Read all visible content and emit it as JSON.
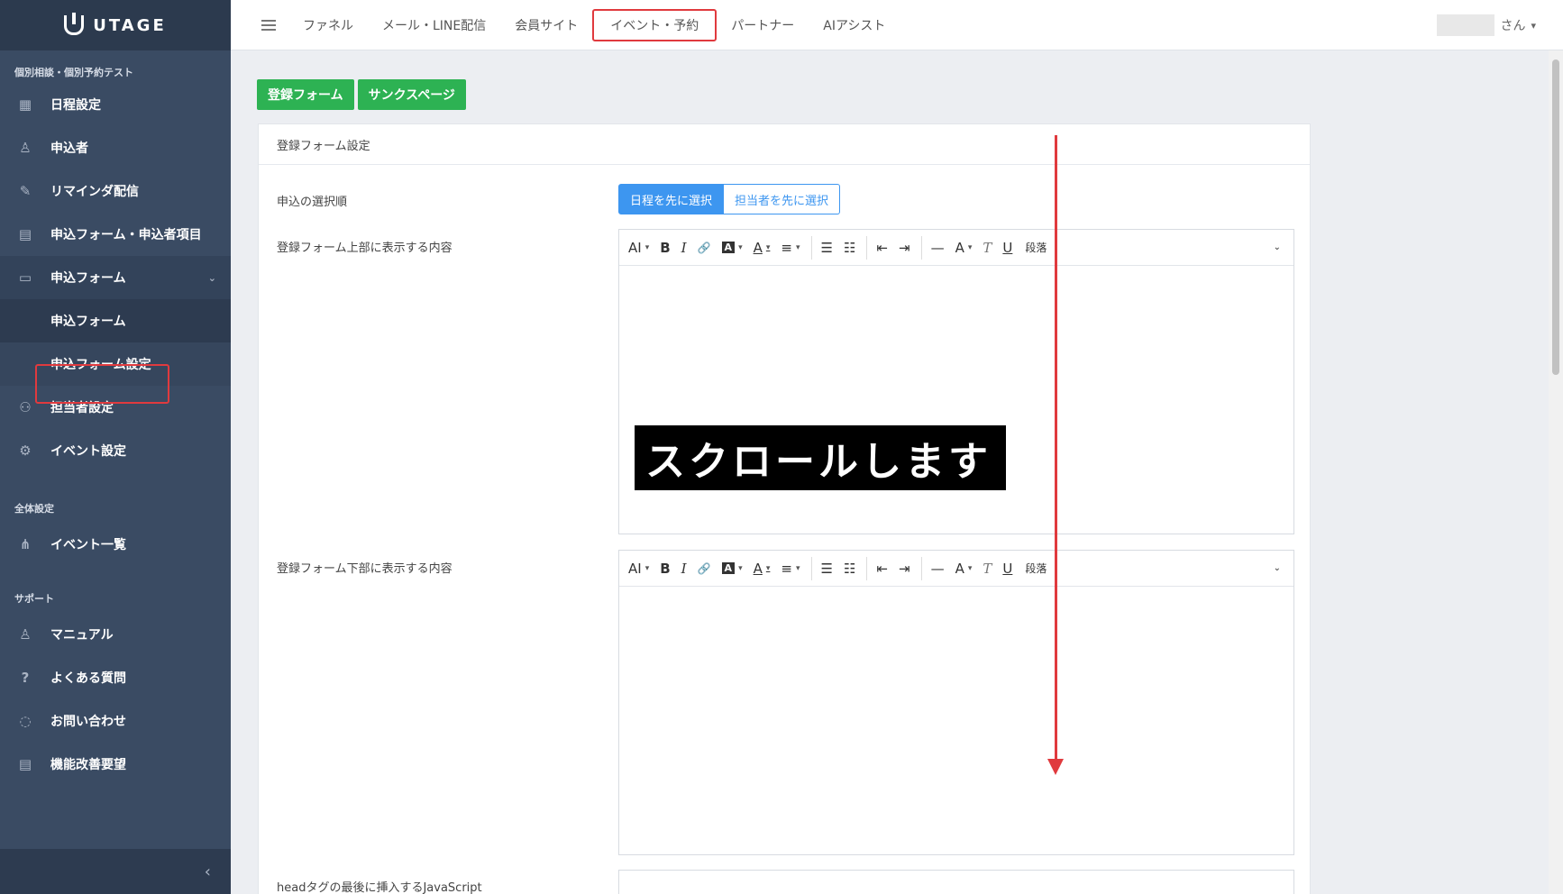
{
  "app": {
    "logo_text": "UTAGE"
  },
  "sidebar": {
    "section1": "個別相談・個別予約テスト",
    "items1": [
      {
        "label": "日程設定",
        "icon": "calendar-icon"
      },
      {
        "label": "申込者",
        "icon": "user-icon"
      },
      {
        "label": "リマインダ配信",
        "icon": "pencil-icon"
      },
      {
        "label": "申込フォーム・申込者項目",
        "icon": "table-icon"
      },
      {
        "label": "申込フォーム",
        "icon": "form-icon"
      }
    ],
    "sub_items": [
      "申込フォーム",
      "申込フォーム設定"
    ],
    "items2": [
      {
        "label": "担当者設定",
        "icon": "users-icon"
      },
      {
        "label": "イベント設定",
        "icon": "gear-icon"
      }
    ],
    "section2": "全体設定",
    "items3": [
      {
        "label": "イベント一覧",
        "icon": "sitemap-icon"
      }
    ],
    "section3": "サポート",
    "items4": [
      {
        "label": "マニュアル",
        "icon": "user-icon"
      },
      {
        "label": "よくある質問",
        "icon": "question-icon"
      },
      {
        "label": "お問い合わせ",
        "icon": "chat-icon"
      },
      {
        "label": "機能改善要望",
        "icon": "document-icon"
      }
    ],
    "collapse_glyph": "‹"
  },
  "topnav": {
    "items": [
      "ファネル",
      "メール・LINE配信",
      "会員サイト",
      "イベント・予約",
      "パートナー",
      "AIアシスト"
    ],
    "user_suffix": "さん",
    "user_caret": "▾"
  },
  "tabs": {
    "form": "登録フォーム",
    "thanks": "サンクスページ"
  },
  "card": {
    "title": "登録フォーム設定",
    "order_label": "申込の選択順",
    "order_on": "日程を先に選択",
    "order_off": "担当者を先に選択",
    "top_label": "登録フォーム上部に表示する内容",
    "bottom_label": "登録フォーム下部に表示する内容",
    "js_label": "headタグの最後に挿入するJavaScript"
  },
  "toolbar": {
    "font_size": "AI",
    "bold": "B",
    "italic": "I",
    "link": "🔗",
    "highlight": "A",
    "font_color": "A",
    "align": "≡",
    "bullets": "☰",
    "numbered": "☷",
    "outdent": "⇤",
    "indent": "⇥",
    "hr": "—",
    "font_style": "A",
    "clear": "T",
    "underline": "U",
    "paragraph": "段落",
    "caret": "⌄"
  },
  "overlay": {
    "text": "スクロールします"
  },
  "colors": {
    "sidebar": "#3a4b63",
    "accent_green": "#2db253",
    "accent_blue": "#3d96f0",
    "annotation_red": "#e03a3e"
  }
}
